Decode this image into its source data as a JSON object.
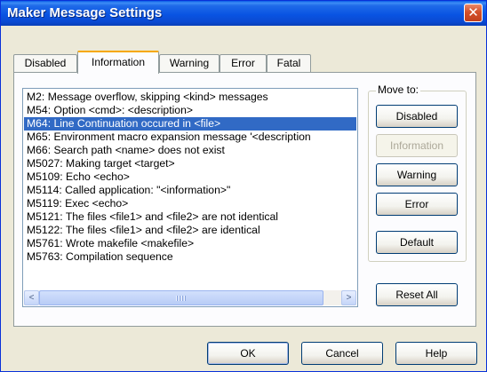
{
  "window": {
    "title": "Maker Message Settings",
    "close_symbol": "✕"
  },
  "tabs": [
    {
      "label": "Disabled"
    },
    {
      "label": "Information"
    },
    {
      "label": "Warning"
    },
    {
      "label": "Error"
    },
    {
      "label": "Fatal"
    }
  ],
  "active_tab": "Information",
  "messages": [
    "M2: Message overflow, skipping <kind> messages",
    "M54: Option <cmd>: <description>",
    "M64: Line Continuation occured in <file>",
    "M65: Environment macro expansion message '<description",
    "M66: Search path <name> does not exist",
    "M5027: Making target <target>",
    "M5109: Echo <echo>",
    "M5114: Called application: \"<information>\"",
    "M5119: Exec <echo>",
    "M5121: The files <file1> and <file2> are not identical",
    "M5122: The files <file1> and <file2> are identical",
    "M5761: Wrote makefile <makefile>",
    "M5763: Compilation sequence"
  ],
  "selected_message": "M64: Line Continuation occured in <file>",
  "move_to": {
    "label": "Move to:",
    "disabled": "Disabled",
    "information": "Information",
    "warning": "Warning",
    "error": "Error"
  },
  "default_button": "Default",
  "reset_all_button": "Reset All",
  "footer": {
    "ok": "OK",
    "cancel": "Cancel",
    "help": "Help"
  },
  "scroll_left_symbol": "<",
  "scroll_right_symbol": ">"
}
